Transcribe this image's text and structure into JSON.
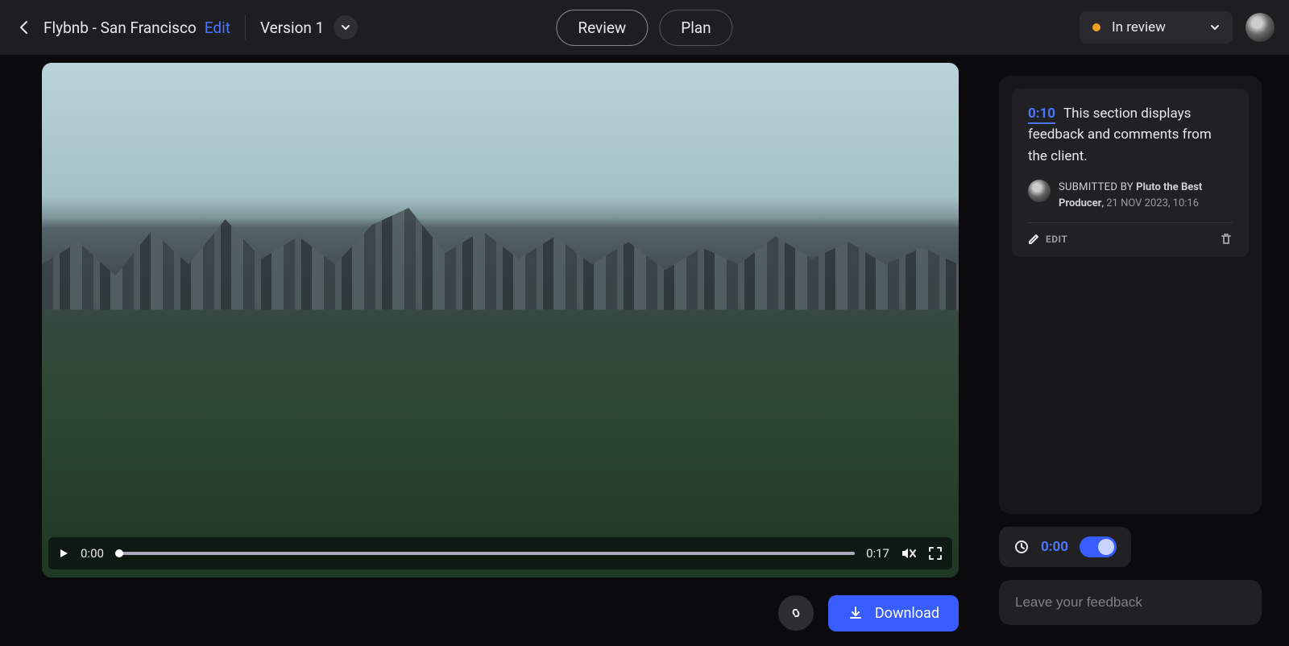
{
  "header": {
    "title": "Flybnb - San Francisco",
    "edit_label": "Edit",
    "version_label": "Version 1",
    "tabs": {
      "review": "Review",
      "plan": "Plan"
    },
    "status": {
      "label": "In review",
      "color": "#f0a020"
    }
  },
  "video": {
    "current_time": "0:00",
    "duration": "0:17"
  },
  "actions": {
    "download_label": "Download"
  },
  "comments": [
    {
      "timestamp": "0:10",
      "text": "This section displays feedback and comments from the client.",
      "submitted_by_label": "SUBMITTED BY",
      "author": "Pluto the Best Producer",
      "date": "21 NOV 2023, 10:16",
      "edit_label": "EDIT"
    }
  ],
  "footer": {
    "time_value": "0:00",
    "feedback_placeholder": "Leave your feedback"
  }
}
